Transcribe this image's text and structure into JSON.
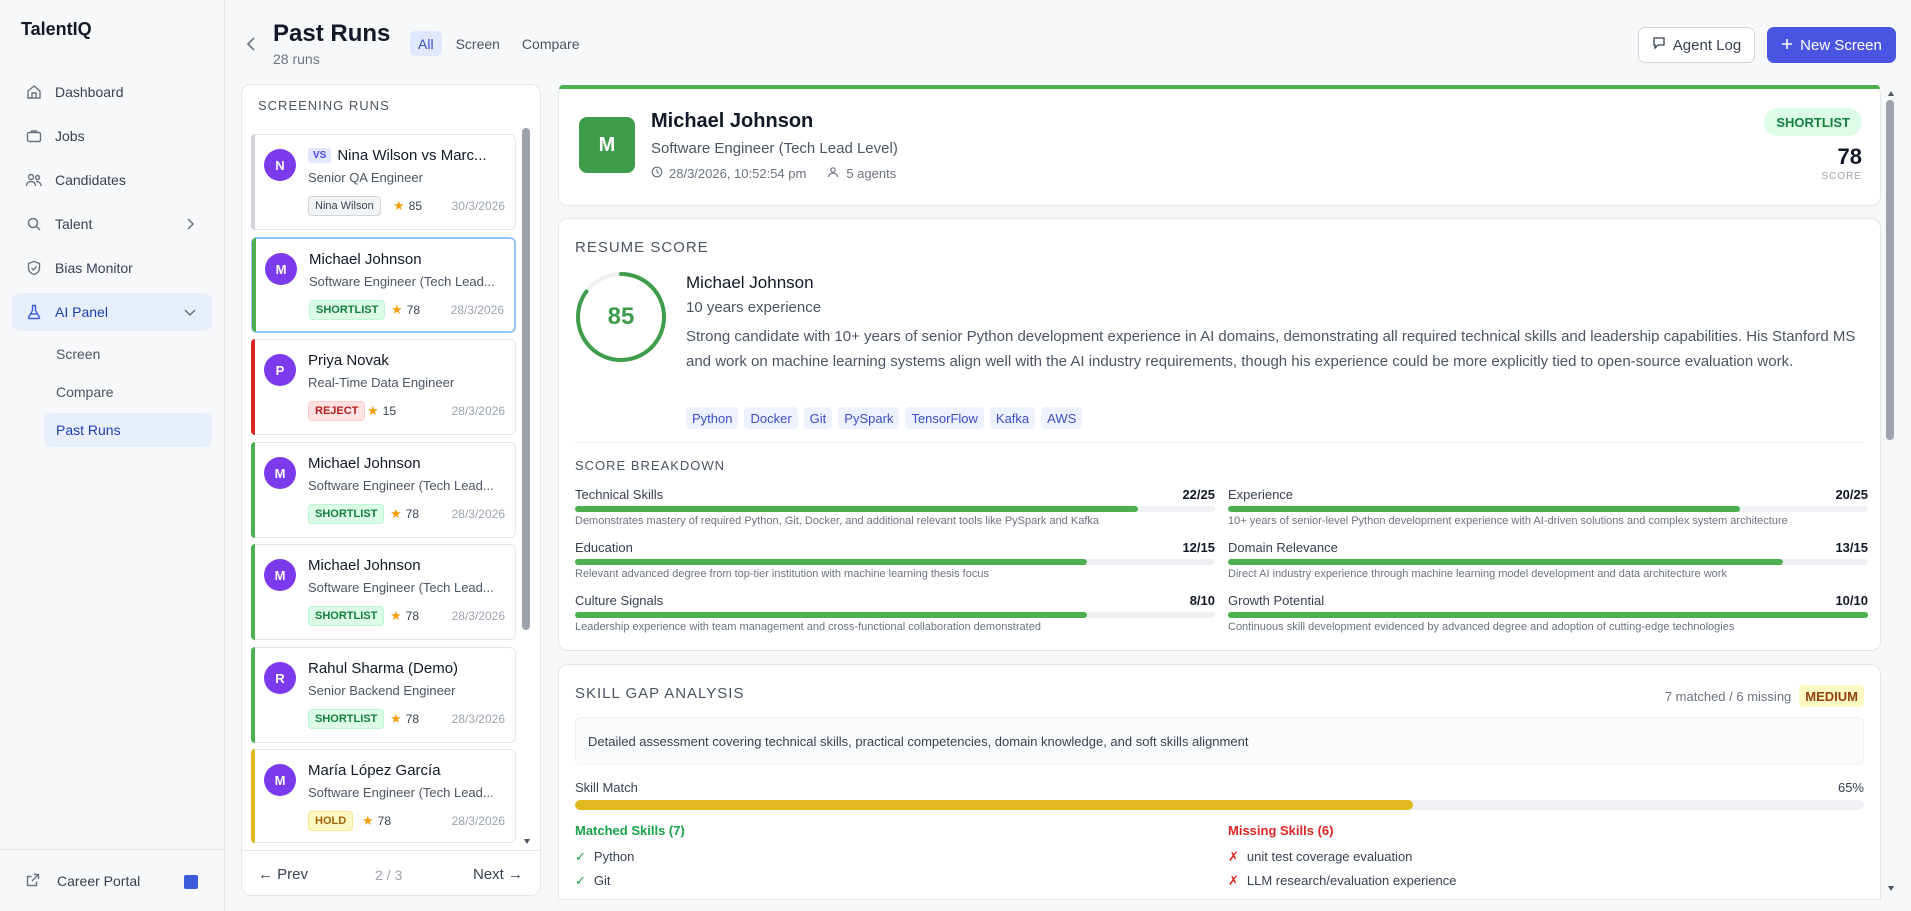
{
  "brand": "TalentIQ",
  "nav": {
    "dashboard": "Dashboard",
    "jobs": "Jobs",
    "candidates": "Candidates",
    "talent": "Talent",
    "bias_monitor": "Bias Monitor",
    "ai_panel": "AI Panel",
    "sub": {
      "screen": "Screen",
      "compare": "Compare",
      "past_runs": "Past Runs"
    },
    "career_portal": "Career Portal"
  },
  "header": {
    "title": "Past Runs",
    "count": "28 runs",
    "filters": [
      "All",
      "Screen",
      "Compare"
    ],
    "agent_log": "Agent Log",
    "new_screen": "New Screen"
  },
  "runs": {
    "heading": "SCREENING RUNS",
    "items": [
      {
        "initial": "N",
        "vs": "VS",
        "name": "Nina Wilson vs Marc...",
        "role": "Senior QA Engineer",
        "badge": "Nina Wilson",
        "score": "85",
        "date": "30/3/2026",
        "accent": "#d1d5db"
      },
      {
        "initial": "M",
        "name": "Michael Johnson",
        "role": "Software Engineer (Tech Lead...",
        "badge": "SHORTLIST",
        "score": "78",
        "date": "28/3/2026",
        "accent": "#4caf50"
      },
      {
        "initial": "P",
        "name": "Priya Novak",
        "role": "Real-Time Data Engineer",
        "badge": "REJECT",
        "score": "15",
        "date": "28/3/2026",
        "accent": "#dc2626"
      },
      {
        "initial": "M",
        "name": "Michael Johnson",
        "role": "Software Engineer (Tech Lead...",
        "badge": "SHORTLIST",
        "score": "78",
        "date": "28/3/2026",
        "accent": "#4caf50"
      },
      {
        "initial": "M",
        "name": "Michael Johnson",
        "role": "Software Engineer (Tech Lead...",
        "badge": "SHORTLIST",
        "score": "78",
        "date": "28/3/2026",
        "accent": "#4caf50"
      },
      {
        "initial": "R",
        "name": "Rahul Sharma (Demo)",
        "role": "Senior Backend Engineer",
        "badge": "SHORTLIST",
        "score": "78",
        "date": "28/3/2026",
        "accent": "#4caf50"
      },
      {
        "initial": "M",
        "name": "María López García",
        "role": "Software Engineer (Tech Lead...",
        "badge": "HOLD",
        "score": "78",
        "date": "28/3/2026",
        "accent": "#e0b81f"
      }
    ],
    "prev": "← Prev",
    "page": "2 / 3",
    "next": "Next →"
  },
  "candidate": {
    "initial": "M",
    "name": "Michael Johnson",
    "role": "Software Engineer (Tech Lead Level)",
    "datetime": "28/3/2026, 10:52:54 pm",
    "agents": "5 agents",
    "decision": "SHORTLIST",
    "score": "78",
    "score_label": "SCORE"
  },
  "resume": {
    "heading": "RESUME SCORE",
    "score": "85",
    "score_fraction": 0.85,
    "name": "Michael Johnson",
    "experience": "10 years experience",
    "summary": "Strong candidate with 10+ years of senior Python development experience in AI domains, demonstrating all required technical skills and leadership capabilities. His Stanford MS and work on machine learning systems align well with the AI industry requirements, though his experience could be more explicitly tied to open-source evaluation work.",
    "tags": [
      "Python",
      "Docker",
      "Git",
      "PySpark",
      "TensorFlow",
      "Kafka",
      "AWS"
    ],
    "breakdown_heading": "SCORE BREAKDOWN",
    "breakdown": [
      {
        "label": "Technical Skills",
        "value": "22/25",
        "fraction": 0.88,
        "desc": "Demonstrates mastery of required Python, Git, Docker, and additional relevant tools like PySpark and Kafka"
      },
      {
        "label": "Experience",
        "value": "20/25",
        "fraction": 0.8,
        "desc": "10+ years of senior-level Python development experience with AI-driven solutions and complex system architecture"
      },
      {
        "label": "Education",
        "value": "12/15",
        "fraction": 0.8,
        "desc": "Relevant advanced degree from top-tier institution with machine learning thesis focus"
      },
      {
        "label": "Domain Relevance",
        "value": "13/15",
        "fraction": 0.867,
        "desc": "Direct AI industry experience through machine learning model development and data architecture work"
      },
      {
        "label": "Culture Signals",
        "value": "8/10",
        "fraction": 0.8,
        "desc": "Leadership experience with team management and cross-functional collaboration demonstrated"
      },
      {
        "label": "Growth Potential",
        "value": "10/10",
        "fraction": 1.0,
        "desc": "Continuous skill development evidenced by advanced degree and adoption of cutting-edge technologies"
      }
    ]
  },
  "skill_gap": {
    "heading": "SKILL GAP ANALYSIS",
    "summary": "7 matched / 6 missing",
    "level": "MEDIUM",
    "description": "Detailed assessment covering technical skills, practical competencies, domain knowledge, and soft skills alignment",
    "match_label": "Skill Match",
    "match_pct": "65%",
    "match_fraction": 0.65,
    "matched_heading": "Matched Skills (7)",
    "missing_heading": "Missing Skills (6)",
    "matched": [
      "Python",
      "Git"
    ],
    "missing": [
      "unit test coverage evaluation",
      "LLM research/evaluation experience"
    ]
  },
  "colors": {
    "accent": "#4a56e2",
    "success": "#4caf50",
    "warning": "#e0b81f",
    "danger": "#dc2626",
    "avatar": "#7c3aed"
  }
}
